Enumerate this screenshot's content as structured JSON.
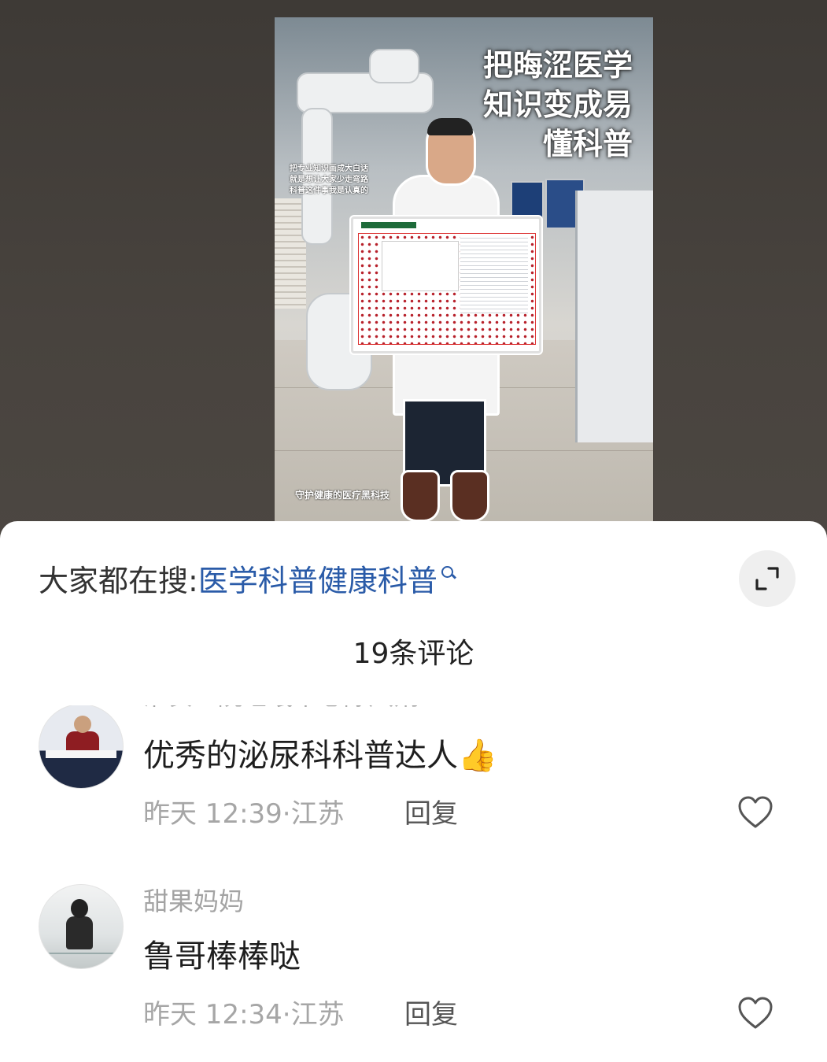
{
  "video": {
    "headline_lines": [
      "把晦涩医学",
      "知识变成易",
      "懂科普"
    ],
    "side_note_lines": [
      "把专业知识画成大白话",
      "就是想让大家少走弯路",
      "科普这件事我是认真的"
    ],
    "caption": "守护健康的医疗黑科技"
  },
  "search": {
    "label": "大家都在搜:",
    "query": "医学科普健康科普"
  },
  "comments_header": {
    "count_text": "19条评论"
  },
  "comments": [
    {
      "username": "淮安 · 院睡眠中心陈凤娟",
      "text": "优秀的泌尿科科普达人",
      "emoji": "👍",
      "time": "昨天 12:39",
      "location": "江苏",
      "reply_label": "回复"
    },
    {
      "username": "甜果妈妈",
      "text": "鲁哥棒棒哒",
      "emoji": "",
      "time": "昨天 12:34",
      "location": "江苏",
      "reply_label": "回复"
    }
  ],
  "colors": {
    "link": "#2a5ba8",
    "meta": "#a6a6a6",
    "sheet_bg": "#ffffff",
    "backdrop": "#4a4540"
  },
  "icons": {
    "search": "search-icon",
    "expand": "expand-icon",
    "like": "heart-icon",
    "thumbs": "thumbs-up-icon"
  }
}
